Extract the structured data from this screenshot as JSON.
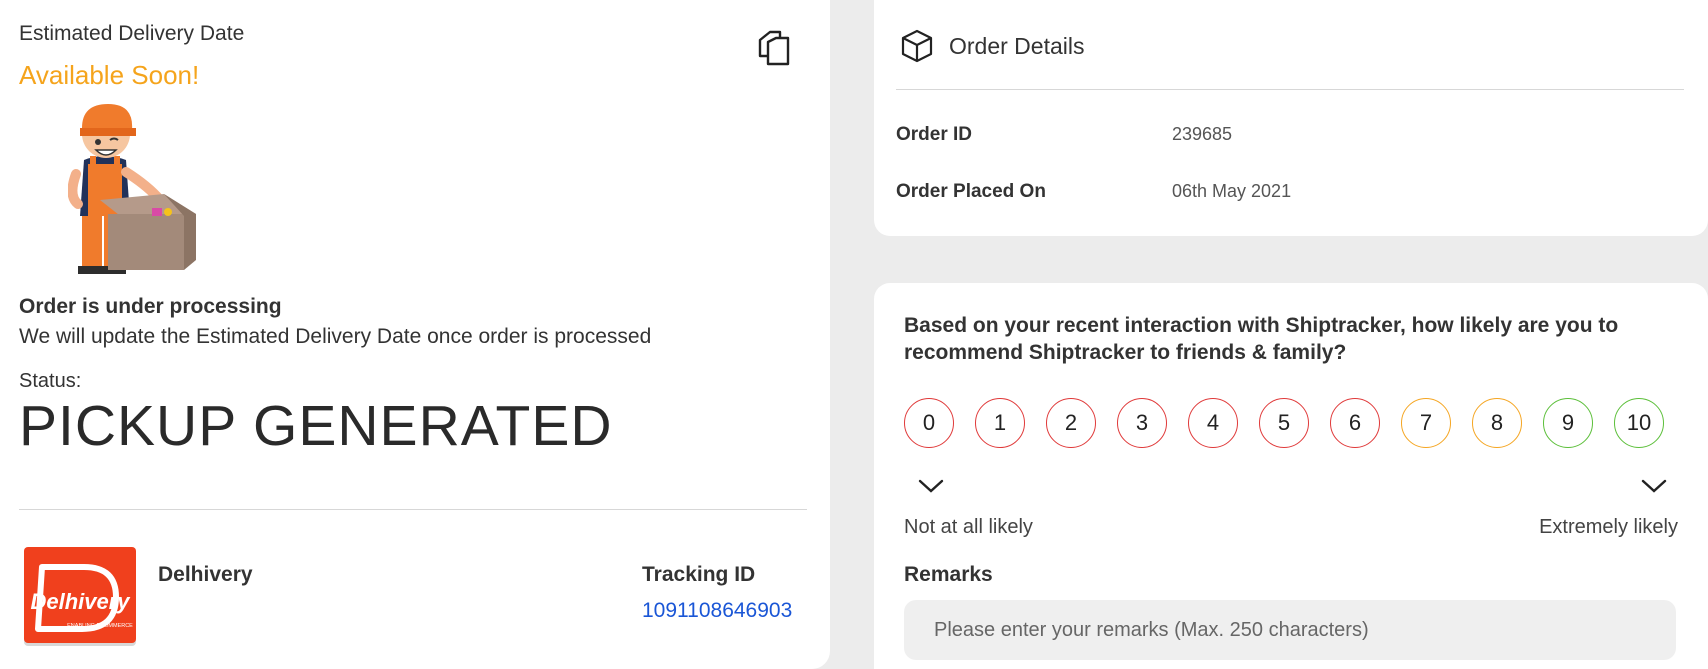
{
  "delivery": {
    "label": "Estimated Delivery Date",
    "value": "Available Soon!",
    "processing_title": "Order is under processing",
    "processing_desc": "We will update the Estimated Delivery Date once order is processed"
  },
  "status": {
    "label": "Status:",
    "value": "PICKUP GENERATED"
  },
  "courier": {
    "name": "Delhivery",
    "logo_text": "Delhivery",
    "logo_sub": "ENABLING ECOMMERCE",
    "tracking_label": "Tracking ID",
    "tracking_id": "1091108646903"
  },
  "order_details": {
    "title": "Order Details",
    "rows": [
      {
        "label": "Order ID",
        "value": "239685"
      },
      {
        "label": "Order Placed On",
        "value": "06th May 2021"
      }
    ]
  },
  "nps": {
    "question": "Based on your recent interaction with Shiptracker, how likely are you to recommend Shiptracker to friends & family?",
    "scale": [
      "0",
      "1",
      "2",
      "3",
      "4",
      "5",
      "6",
      "7",
      "8",
      "9",
      "10"
    ],
    "scale_colors": [
      "#e03a3a",
      "#e03a3a",
      "#e03a3a",
      "#e03a3a",
      "#e03a3a",
      "#e03a3a",
      "#e03a3a",
      "#f5a623",
      "#f5a623",
      "#5cbf3a",
      "#5cbf3a"
    ],
    "low_label": "Not at all likely",
    "high_label": "Extremely likely"
  },
  "remarks": {
    "label": "Remarks",
    "placeholder": "Please enter your remarks (Max. 250 characters)"
  },
  "colors": {
    "accent_orange": "#f5a41c",
    "link_blue": "#1a56d6",
    "brand_red": "#f0401d"
  },
  "icons": {
    "copy": "copy-icon",
    "box": "box-icon",
    "chevron": "chevron-down-icon"
  }
}
